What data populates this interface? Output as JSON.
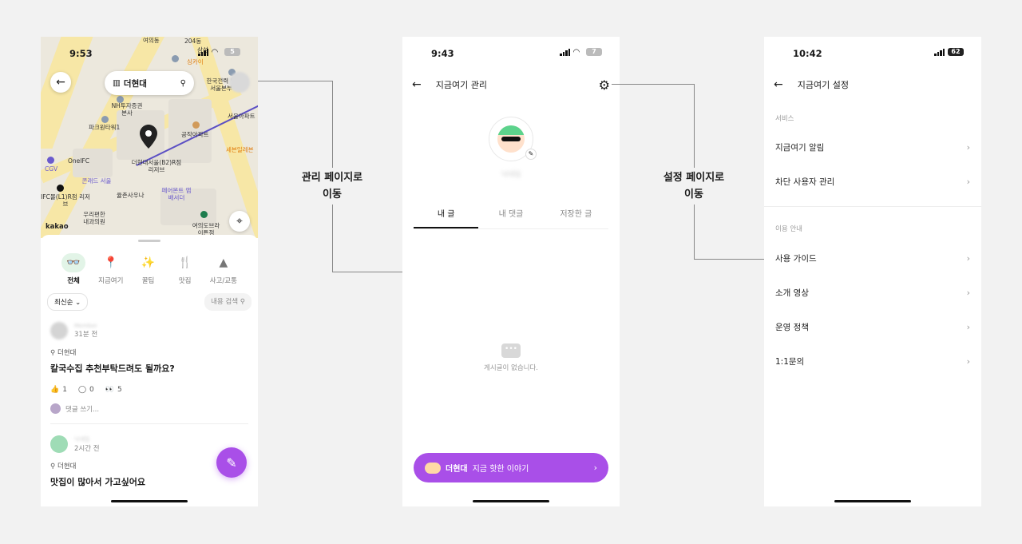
{
  "phone1": {
    "status": {
      "time": "9:53",
      "battery": "5"
    },
    "map": {
      "search_label": "더현대",
      "labels": [
        "여의동",
        "204동",
        "삼성",
        "싱카이",
        "한국전력 남서울본부",
        "NH투자증권 본사",
        "파크원타워1",
        "서울아파트",
        "공작아파트",
        "세븐일레븐",
        "OneIFC",
        "CGV",
        "콘래드 서울",
        "더현대서울(B2)R점 리저브",
        "율촌사우나",
        "페어몬트 앰배서더",
        "IFC몰(L1)R점 리저브",
        "우리편한 내과의원",
        "여의도브라 이튼점"
      ],
      "attribution": "kakao"
    },
    "categories": [
      {
        "label": "전체",
        "icon": "glasses-icon",
        "active": true
      },
      {
        "label": "지금여기",
        "icon": "location-icon",
        "active": false
      },
      {
        "label": "꿀팁",
        "icon": "sparkle-icon",
        "active": false
      },
      {
        "label": "맛집",
        "icon": "utensils-icon",
        "active": false
      },
      {
        "label": "사고/교통",
        "icon": "cone-icon",
        "active": false
      }
    ],
    "sort_label": "최신순",
    "content_search_label": "내용 검색",
    "posts": [
      {
        "username": "Member",
        "ago": "31분 전",
        "location": "더현대",
        "title": "칼국수집 추천부탁드려도 될까요?",
        "likes": "1",
        "comments": "0",
        "views": "5",
        "comment_placeholder": "댓글 쓰기..."
      },
      {
        "username": "닉네임",
        "ago": "2시간 전",
        "location": "더현대",
        "title": "맛집이 많아서 가고싶어요"
      }
    ]
  },
  "annotation1": {
    "line1": "관리 페이지로",
    "line2": "이동"
  },
  "annotation2": {
    "line1": "설정 페이지로",
    "line2": "이동"
  },
  "phone2": {
    "status": {
      "time": "9:43",
      "battery": "7"
    },
    "title": "지금여기 관리",
    "nickname": "닉네임",
    "tabs": [
      "내 글",
      "내 댓글",
      "저장한 글"
    ],
    "empty_text": "게시글이 없습니다.",
    "cta": {
      "place": "더현대",
      "text": "지금 핫한 이야기"
    }
  },
  "phone3": {
    "status": {
      "time": "10:42",
      "battery": "62"
    },
    "title": "지금여기 설정",
    "sections": [
      {
        "label": "서비스",
        "items": [
          "지금여기 알림",
          "차단 사용자 관리"
        ]
      },
      {
        "label": "이용 안내",
        "items": [
          "사용 가이드",
          "소개 영상",
          "운영 정책",
          "1:1문의"
        ]
      }
    ]
  },
  "colors": {
    "accent": "#a94fe8",
    "background": "#f2f2f2",
    "active_tab": "#111111"
  }
}
